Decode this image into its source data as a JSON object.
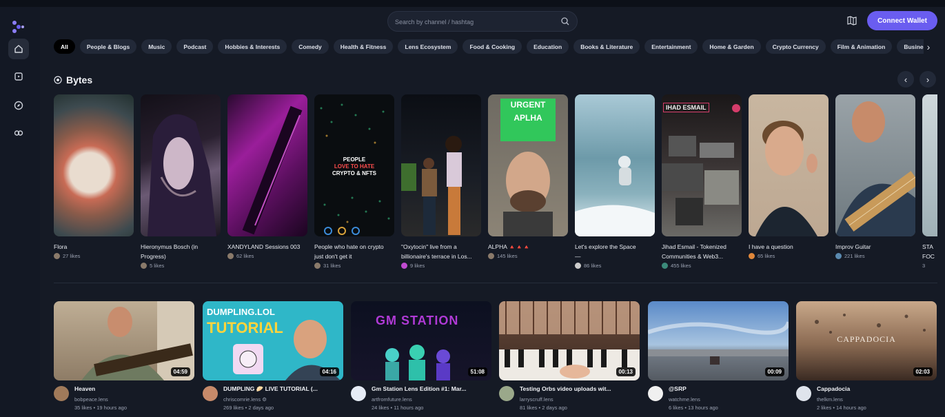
{
  "header": {
    "search_placeholder": "Search by channel / hashtag",
    "connect_label": "Connect Wallet"
  },
  "sidebar": {
    "items": [
      "home-icon",
      "library-icon",
      "explore-icon",
      "lens-icon"
    ]
  },
  "categories": [
    "All",
    "People & Blogs",
    "Music",
    "Podcast",
    "Hobbies & Interests",
    "Comedy",
    "Health & Fitness",
    "Lens Ecosystem",
    "Food & Cooking",
    "Education",
    "Books & Literature",
    "Entertainment",
    "Home & Garden",
    "Crypto Currency",
    "Film & Animation",
    "Business"
  ],
  "bytes": {
    "title": "Bytes",
    "items": [
      {
        "title": "Flora",
        "likes": "27 likes"
      },
      {
        "title": "Hieronymus Bosch (in Progress)",
        "likes": "5 likes"
      },
      {
        "title": "XANDYLAND Sessions 003",
        "likes": "62 likes"
      },
      {
        "title": "People who hate on crypto just don't get it",
        "likes": "31 likes",
        "overlay": [
          "PEOPLE",
          "LOVE TO HATE",
          "CRYPTO & NFTS"
        ]
      },
      {
        "title": "\"Oxytocin\" live from a billionaire's terrace in Los...",
        "likes": "9 likes"
      },
      {
        "title": "ALPHA 🔺🔺🔺",
        "likes": "145 likes",
        "overlay": [
          "URGENT",
          "APLHA"
        ]
      },
      {
        "title": "Let's explore the Space",
        "extra": "—",
        "likes": "86 likes"
      },
      {
        "title": "Jihad Esmail - Tokenized Communities & Web3...",
        "likes": "455 likes",
        "overlay": [
          "IHAD ESMAIL"
        ]
      },
      {
        "title": "I have a question",
        "likes": "65 likes"
      },
      {
        "title": "Improv Guitar",
        "likes": "221 likes"
      },
      {
        "title": "STA FOC",
        "likes": "3"
      }
    ]
  },
  "videos": [
    {
      "title": "Heaven",
      "channel": "bobpeace.lens",
      "stats": "35 likes • 19 hours ago",
      "duration": "04:59"
    },
    {
      "title": "DUMPLING 🥟 LIVE TUTORIAL (...",
      "channel": "chriscomrie.lens ⚙",
      "stats": "269 likes • 2 days ago",
      "duration": "04:16",
      "overlay": [
        "DUMPLING.LOL",
        "TUTORIAL"
      ]
    },
    {
      "title": "Gm Station Lens Edition #1: Mar...",
      "channel": "artfromfuture.lens",
      "stats": "24 likes • 11 hours ago",
      "duration": "51:08",
      "overlay": [
        "GM STATION"
      ]
    },
    {
      "title": "Testing Orbs video uploads wit...",
      "channel": "larryscruff.lens",
      "stats": "81 likes • 2 days ago",
      "duration": "00:13"
    },
    {
      "title": "@SRP",
      "channel": "watchme.lens",
      "stats": "6 likes • 13 hours ago",
      "duration": "00:09"
    },
    {
      "title": "Cappadocia",
      "channel": "thelkm.lens",
      "stats": "2 likes • 14 hours ago",
      "duration": "02:03",
      "overlay": [
        "CAPPADOCIA"
      ]
    }
  ],
  "colors": {
    "accent": "#6a5df0",
    "background": "#151a25",
    "chip": "#222938"
  }
}
